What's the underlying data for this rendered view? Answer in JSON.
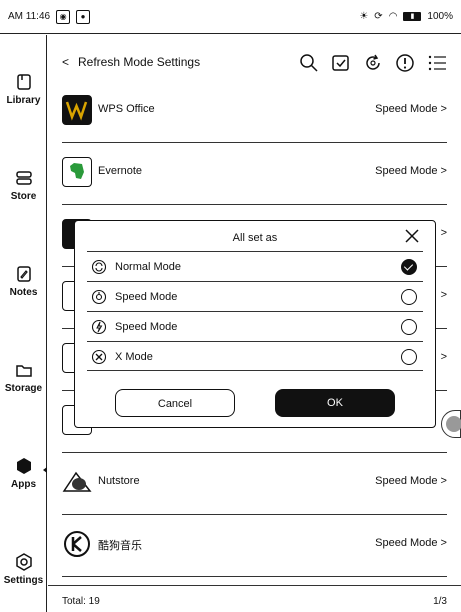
{
  "status": {
    "time": "AM 11:46",
    "battery": "100%"
  },
  "sidebar": {
    "items": [
      {
        "label": "Library",
        "icon": "library-icon"
      },
      {
        "label": "Store",
        "icon": "store-icon"
      },
      {
        "label": "Notes",
        "icon": "notes-icon"
      },
      {
        "label": "Storage",
        "icon": "storage-icon"
      },
      {
        "label": "Apps",
        "icon": "apps-icon",
        "active": true
      },
      {
        "label": "Settings",
        "icon": "settings-icon"
      }
    ]
  },
  "header": {
    "back": "<",
    "title": "Refresh Mode Settings"
  },
  "apps": [
    {
      "name": "WPS Office",
      "mode": "Speed Mode >"
    },
    {
      "name": "Evernote",
      "mode": "Speed Mode >"
    },
    {
      "name": "",
      "mode": ">"
    },
    {
      "name": "",
      "mode": ">"
    },
    {
      "name": "",
      "mode": ">"
    },
    {
      "name": "",
      "mode": ""
    },
    {
      "name": "Nutstore",
      "mode": "Speed Mode >"
    },
    {
      "name": "酷狗音乐",
      "mode": "Speed Mode >"
    }
  ],
  "footer": {
    "total": "Total: 19",
    "page": "1/3"
  },
  "dialog": {
    "title": "All set as",
    "options": [
      {
        "label": "Normal Mode",
        "selected": true
      },
      {
        "label": "Speed Mode",
        "selected": false
      },
      {
        "label": "Speed Mode",
        "selected": false
      },
      {
        "label": "X Mode",
        "selected": false
      }
    ],
    "cancel": "Cancel",
    "ok": "OK"
  }
}
